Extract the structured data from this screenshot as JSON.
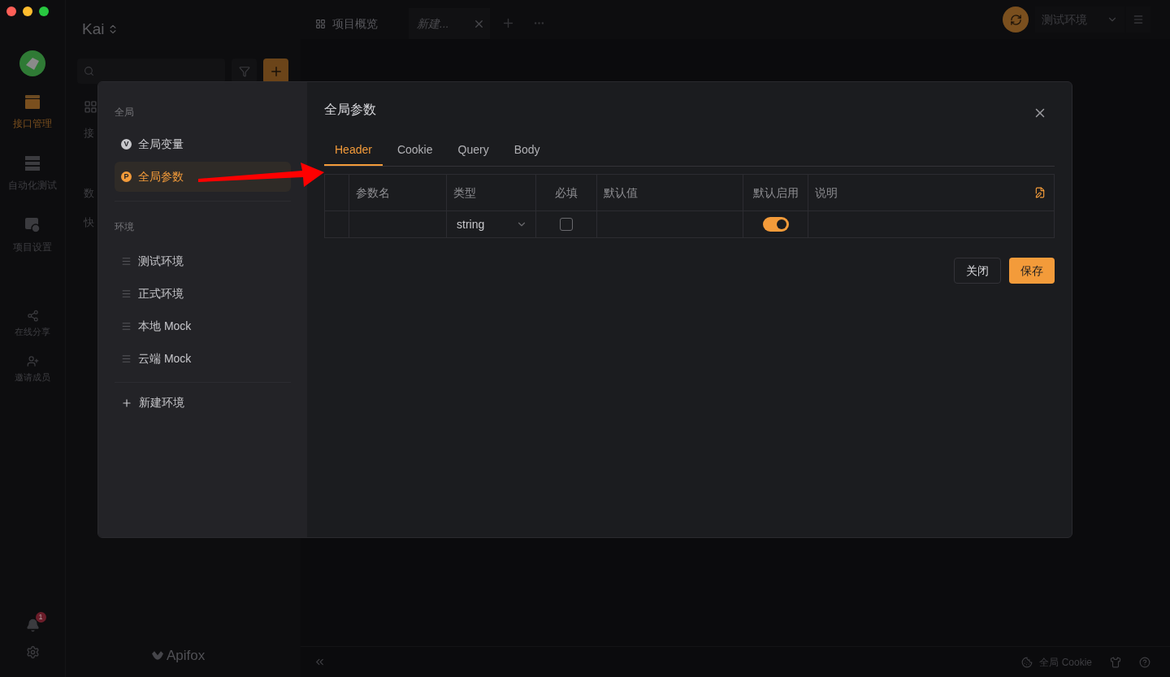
{
  "sidebar": {
    "project_name": "Kai",
    "nav": [
      {
        "label": "接口管理",
        "kind": "main",
        "selected": true
      },
      {
        "label": "自动化测试",
        "kind": "main",
        "selected": false
      },
      {
        "label": "项目设置",
        "kind": "main",
        "selected": false
      },
      {
        "label": "在线分享",
        "kind": "small",
        "selected": false
      },
      {
        "label": "邀请成员",
        "kind": "small",
        "selected": false
      }
    ],
    "notification_count": "1"
  },
  "tree_column": {
    "items": [
      "接",
      "数",
      "快"
    ],
    "brand": "Apifox"
  },
  "tabs": [
    {
      "label": "项目概览",
      "kind": "overview",
      "selected": false
    },
    {
      "label": "新建...",
      "kind": "new",
      "selected": true
    }
  ],
  "environment_select": {
    "value": "测试环境"
  },
  "status_bar": {
    "cookie": "全局 Cookie"
  },
  "dialog": {
    "title": "全局参数",
    "menu_groups": [
      {
        "heading": "全局",
        "kind": "global",
        "items": [
          {
            "label": "全局变量",
            "badge": "V",
            "selected": false
          },
          {
            "label": "全局参数",
            "badge": "P",
            "selected": true
          }
        ]
      },
      {
        "heading": "环境",
        "kind": "env",
        "items": [
          {
            "label": "测试环境",
            "selected": false
          },
          {
            "label": "正式环境",
            "selected": false
          },
          {
            "label": "本地 Mock",
            "selected": false
          },
          {
            "label": "云端 Mock",
            "selected": false
          }
        ]
      }
    ],
    "new_environment": "新建环境",
    "tabs": [
      {
        "label": "Header",
        "selected": true
      },
      {
        "label": "Cookie",
        "selected": false
      },
      {
        "label": "Query",
        "selected": false
      },
      {
        "label": "Body",
        "selected": false
      }
    ],
    "table": {
      "columns": [
        "参数名",
        "类型",
        "必填",
        "默认值",
        "默认启用",
        "说明"
      ],
      "rows": [
        {
          "type": "string",
          "required": false,
          "enabled": true
        }
      ]
    },
    "buttons": [
      {
        "label": "关闭",
        "kind": "secondary"
      },
      {
        "label": "保存",
        "kind": "primary"
      }
    ]
  }
}
